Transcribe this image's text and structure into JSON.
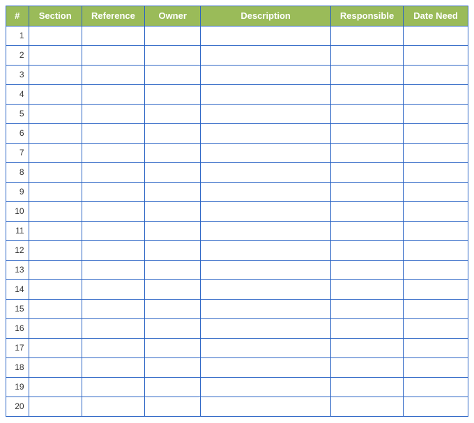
{
  "table": {
    "headers": {
      "num": "#",
      "section": "Section",
      "reference": "Reference",
      "owner": "Owner",
      "description": "Description",
      "responsible": "Responsible",
      "date_need": "Date Need"
    },
    "rows": [
      {
        "num": "1",
        "section": "",
        "reference": "",
        "owner": "",
        "description": "",
        "responsible": "",
        "date_need": ""
      },
      {
        "num": "2",
        "section": "",
        "reference": "",
        "owner": "",
        "description": "",
        "responsible": "",
        "date_need": ""
      },
      {
        "num": "3",
        "section": "",
        "reference": "",
        "owner": "",
        "description": "",
        "responsible": "",
        "date_need": ""
      },
      {
        "num": "4",
        "section": "",
        "reference": "",
        "owner": "",
        "description": "",
        "responsible": "",
        "date_need": ""
      },
      {
        "num": "5",
        "section": "",
        "reference": "",
        "owner": "",
        "description": "",
        "responsible": "",
        "date_need": ""
      },
      {
        "num": "6",
        "section": "",
        "reference": "",
        "owner": "",
        "description": "",
        "responsible": "",
        "date_need": ""
      },
      {
        "num": "7",
        "section": "",
        "reference": "",
        "owner": "",
        "description": "",
        "responsible": "",
        "date_need": ""
      },
      {
        "num": "8",
        "section": "",
        "reference": "",
        "owner": "",
        "description": "",
        "responsible": "",
        "date_need": ""
      },
      {
        "num": "9",
        "section": "",
        "reference": "",
        "owner": "",
        "description": "",
        "responsible": "",
        "date_need": ""
      },
      {
        "num": "10",
        "section": "",
        "reference": "",
        "owner": "",
        "description": "",
        "responsible": "",
        "date_need": ""
      },
      {
        "num": "11",
        "section": "",
        "reference": "",
        "owner": "",
        "description": "",
        "responsible": "",
        "date_need": ""
      },
      {
        "num": "12",
        "section": "",
        "reference": "",
        "owner": "",
        "description": "",
        "responsible": "",
        "date_need": ""
      },
      {
        "num": "13",
        "section": "",
        "reference": "",
        "owner": "",
        "description": "",
        "responsible": "",
        "date_need": ""
      },
      {
        "num": "14",
        "section": "",
        "reference": "",
        "owner": "",
        "description": "",
        "responsible": "",
        "date_need": ""
      },
      {
        "num": "15",
        "section": "",
        "reference": "",
        "owner": "",
        "description": "",
        "responsible": "",
        "date_need": ""
      },
      {
        "num": "16",
        "section": "",
        "reference": "",
        "owner": "",
        "description": "",
        "responsible": "",
        "date_need": ""
      },
      {
        "num": "17",
        "section": "",
        "reference": "",
        "owner": "",
        "description": "",
        "responsible": "",
        "date_need": ""
      },
      {
        "num": "18",
        "section": "",
        "reference": "",
        "owner": "",
        "description": "",
        "responsible": "",
        "date_need": ""
      },
      {
        "num": "19",
        "section": "",
        "reference": "",
        "owner": "",
        "description": "",
        "responsible": "",
        "date_need": ""
      },
      {
        "num": "20",
        "section": "",
        "reference": "",
        "owner": "",
        "description": "",
        "responsible": "",
        "date_need": ""
      }
    ]
  }
}
